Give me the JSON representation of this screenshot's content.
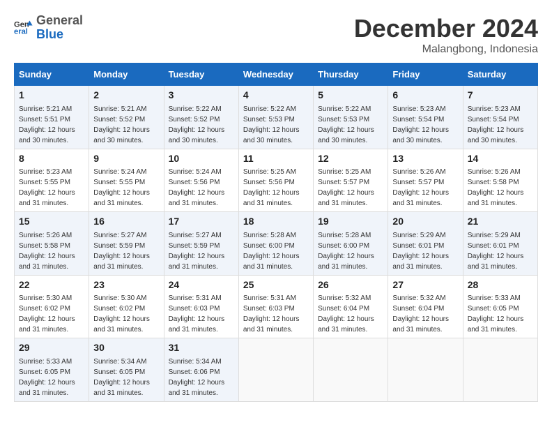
{
  "logo": {
    "general": "General",
    "blue": "Blue"
  },
  "title": "December 2024",
  "location": "Malangbong, Indonesia",
  "headers": [
    "Sunday",
    "Monday",
    "Tuesday",
    "Wednesday",
    "Thursday",
    "Friday",
    "Saturday"
  ],
  "weeks": [
    [
      {
        "day": "1",
        "sunrise": "5:21 AM",
        "sunset": "5:51 PM",
        "daylight": "12 hours and 30 minutes."
      },
      {
        "day": "2",
        "sunrise": "5:21 AM",
        "sunset": "5:52 PM",
        "daylight": "12 hours and 30 minutes."
      },
      {
        "day": "3",
        "sunrise": "5:22 AM",
        "sunset": "5:52 PM",
        "daylight": "12 hours and 30 minutes."
      },
      {
        "day": "4",
        "sunrise": "5:22 AM",
        "sunset": "5:53 PM",
        "daylight": "12 hours and 30 minutes."
      },
      {
        "day": "5",
        "sunrise": "5:22 AM",
        "sunset": "5:53 PM",
        "daylight": "12 hours and 30 minutes."
      },
      {
        "day": "6",
        "sunrise": "5:23 AM",
        "sunset": "5:54 PM",
        "daylight": "12 hours and 30 minutes."
      },
      {
        "day": "7",
        "sunrise": "5:23 AM",
        "sunset": "5:54 PM",
        "daylight": "12 hours and 30 minutes."
      }
    ],
    [
      {
        "day": "8",
        "sunrise": "5:23 AM",
        "sunset": "5:55 PM",
        "daylight": "12 hours and 31 minutes."
      },
      {
        "day": "9",
        "sunrise": "5:24 AM",
        "sunset": "5:55 PM",
        "daylight": "12 hours and 31 minutes."
      },
      {
        "day": "10",
        "sunrise": "5:24 AM",
        "sunset": "5:56 PM",
        "daylight": "12 hours and 31 minutes."
      },
      {
        "day": "11",
        "sunrise": "5:25 AM",
        "sunset": "5:56 PM",
        "daylight": "12 hours and 31 minutes."
      },
      {
        "day": "12",
        "sunrise": "5:25 AM",
        "sunset": "5:57 PM",
        "daylight": "12 hours and 31 minutes."
      },
      {
        "day": "13",
        "sunrise": "5:26 AM",
        "sunset": "5:57 PM",
        "daylight": "12 hours and 31 minutes."
      },
      {
        "day": "14",
        "sunrise": "5:26 AM",
        "sunset": "5:58 PM",
        "daylight": "12 hours and 31 minutes."
      }
    ],
    [
      {
        "day": "15",
        "sunrise": "5:26 AM",
        "sunset": "5:58 PM",
        "daylight": "12 hours and 31 minutes."
      },
      {
        "day": "16",
        "sunrise": "5:27 AM",
        "sunset": "5:59 PM",
        "daylight": "12 hours and 31 minutes."
      },
      {
        "day": "17",
        "sunrise": "5:27 AM",
        "sunset": "5:59 PM",
        "daylight": "12 hours and 31 minutes."
      },
      {
        "day": "18",
        "sunrise": "5:28 AM",
        "sunset": "6:00 PM",
        "daylight": "12 hours and 31 minutes."
      },
      {
        "day": "19",
        "sunrise": "5:28 AM",
        "sunset": "6:00 PM",
        "daylight": "12 hours and 31 minutes."
      },
      {
        "day": "20",
        "sunrise": "5:29 AM",
        "sunset": "6:01 PM",
        "daylight": "12 hours and 31 minutes."
      },
      {
        "day": "21",
        "sunrise": "5:29 AM",
        "sunset": "6:01 PM",
        "daylight": "12 hours and 31 minutes."
      }
    ],
    [
      {
        "day": "22",
        "sunrise": "5:30 AM",
        "sunset": "6:02 PM",
        "daylight": "12 hours and 31 minutes."
      },
      {
        "day": "23",
        "sunrise": "5:30 AM",
        "sunset": "6:02 PM",
        "daylight": "12 hours and 31 minutes."
      },
      {
        "day": "24",
        "sunrise": "5:31 AM",
        "sunset": "6:03 PM",
        "daylight": "12 hours and 31 minutes."
      },
      {
        "day": "25",
        "sunrise": "5:31 AM",
        "sunset": "6:03 PM",
        "daylight": "12 hours and 31 minutes."
      },
      {
        "day": "26",
        "sunrise": "5:32 AM",
        "sunset": "6:04 PM",
        "daylight": "12 hours and 31 minutes."
      },
      {
        "day": "27",
        "sunrise": "5:32 AM",
        "sunset": "6:04 PM",
        "daylight": "12 hours and 31 minutes."
      },
      {
        "day": "28",
        "sunrise": "5:33 AM",
        "sunset": "6:05 PM",
        "daylight": "12 hours and 31 minutes."
      }
    ],
    [
      {
        "day": "29",
        "sunrise": "5:33 AM",
        "sunset": "6:05 PM",
        "daylight": "12 hours and 31 minutes."
      },
      {
        "day": "30",
        "sunrise": "5:34 AM",
        "sunset": "6:05 PM",
        "daylight": "12 hours and 31 minutes."
      },
      {
        "day": "31",
        "sunrise": "5:34 AM",
        "sunset": "6:06 PM",
        "daylight": "12 hours and 31 minutes."
      },
      null,
      null,
      null,
      null
    ]
  ]
}
